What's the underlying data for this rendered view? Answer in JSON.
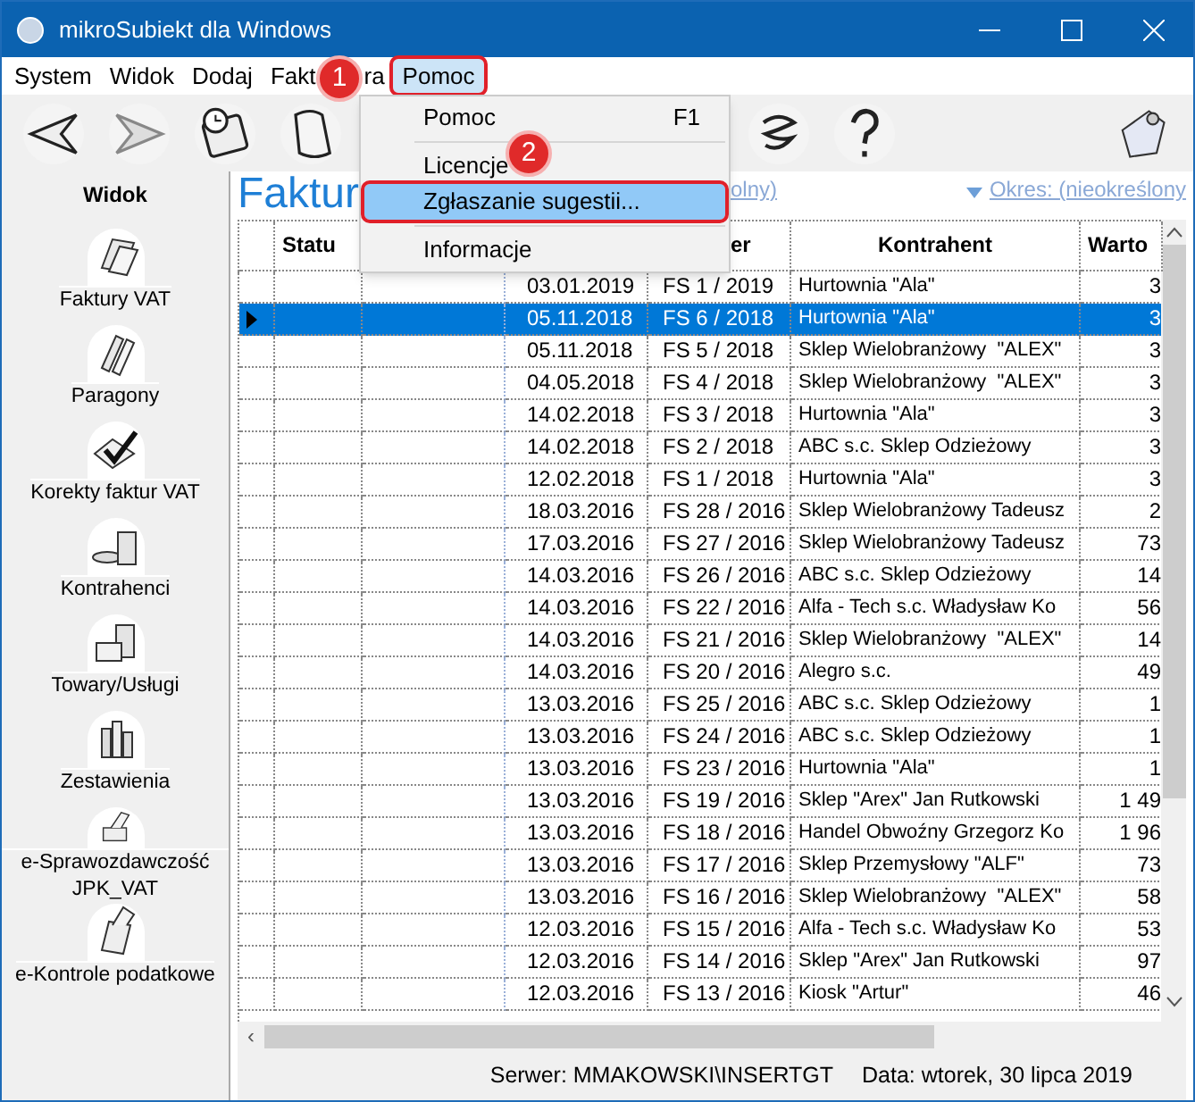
{
  "window": {
    "title": "mikroSubiekt dla Windows"
  },
  "menu_bar": [
    {
      "label": "System",
      "selected": false
    },
    {
      "label": "Widok",
      "selected": false
    },
    {
      "label": "Dodaj",
      "selected": false
    },
    {
      "label": "Fakt",
      "tail": "ra",
      "selected": false
    },
    {
      "label": "Pomoc",
      "selected": true
    }
  ],
  "dropdown": {
    "items": [
      {
        "kind": "item",
        "label": "Pomoc",
        "shortcut": "F1",
        "selected": false
      },
      {
        "kind": "separator"
      },
      {
        "kind": "item",
        "label": "Licencje",
        "selected": false
      },
      {
        "kind": "item",
        "label": "Zgłaszanie sugestii...",
        "selected": true
      },
      {
        "kind": "separator"
      },
      {
        "kind": "item",
        "label": "Informacje",
        "selected": false
      }
    ]
  },
  "step_badges": [
    "1",
    "2"
  ],
  "sidebar": {
    "title": "Widok",
    "items": [
      {
        "label": "Faktury VAT"
      },
      {
        "label": "Paragony"
      },
      {
        "label": "Korekty faktur VAT"
      },
      {
        "label": "Kontrahenci"
      },
      {
        "label": "Towary/Usługi"
      },
      {
        "label": "Zestawienia"
      },
      {
        "label": "e-Sprawozdawczość JPK_VAT"
      },
      {
        "label": "e-Kontrole podatkowe"
      }
    ]
  },
  "page": {
    "title": "Faktur",
    "filter_link": "olny)",
    "period_link": "Okres: (nieokreślony"
  },
  "table": {
    "columns": [
      "",
      "Statu",
      "",
      "",
      "er",
      "Kontrahent",
      "Warto"
    ],
    "scroll_left": "‹",
    "rows": [
      {
        "date": "03.01.2019",
        "number": "FS 1 / 2019",
        "party": "Hurtownia \"Ala\"",
        "value": "3",
        "selected": false
      },
      {
        "date": "05.11.2018",
        "number": "FS 6 / 2018",
        "party": "Hurtownia \"Ala\"",
        "value": "3",
        "selected": true
      },
      {
        "date": "05.11.2018",
        "number": "FS 5 / 2018",
        "party": "Sklep Wielobranżowy  \"ALEX\"",
        "value": "3",
        "selected": false
      },
      {
        "date": "04.05.2018",
        "number": "FS 4 / 2018",
        "party": "Sklep Wielobranżowy  \"ALEX\"",
        "value": "3",
        "selected": false
      },
      {
        "date": "14.02.2018",
        "number": "FS 3 / 2018",
        "party": "Hurtownia \"Ala\"",
        "value": "3",
        "selected": false
      },
      {
        "date": "14.02.2018",
        "number": "FS 2 / 2018",
        "party": "ABC s.c. Sklep Odzieżowy",
        "value": "3",
        "selected": false
      },
      {
        "date": "12.02.2018",
        "number": "FS 1 / 2018",
        "party": "Hurtownia \"Ala\"",
        "value": "3",
        "selected": false
      },
      {
        "date": "18.03.2016",
        "number": "FS 28 / 2016",
        "party": "Sklep Wielobranżowy Tadeusz",
        "value": "2",
        "selected": false
      },
      {
        "date": "17.03.2016",
        "number": "FS 27 / 2016",
        "party": "Sklep Wielobranżowy Tadeusz",
        "value": "73",
        "selected": false
      },
      {
        "date": "14.03.2016",
        "number": "FS 26 / 2016",
        "party": "ABC s.c. Sklep Odzieżowy",
        "value": "14",
        "selected": false
      },
      {
        "date": "14.03.2016",
        "number": "FS 22 / 2016",
        "party": "Alfa - Tech s.c. Władysław Ko",
        "value": "56",
        "selected": false
      },
      {
        "date": "14.03.2016",
        "number": "FS 21 / 2016",
        "party": "Sklep Wielobranżowy  \"ALEX\"",
        "value": "14",
        "selected": false
      },
      {
        "date": "14.03.2016",
        "number": "FS 20 / 2016",
        "party": "Alegro s.c.",
        "value": "49",
        "selected": false
      },
      {
        "date": "13.03.2016",
        "number": "FS 25 / 2016",
        "party": "ABC s.c. Sklep Odzieżowy",
        "value": "1",
        "selected": false
      },
      {
        "date": "13.03.2016",
        "number": "FS 24 / 2016",
        "party": "ABC s.c. Sklep Odzieżowy",
        "value": "1",
        "selected": false
      },
      {
        "date": "13.03.2016",
        "number": "FS 23 / 2016",
        "party": "Hurtownia \"Ala\"",
        "value": "1",
        "selected": false
      },
      {
        "date": "13.03.2016",
        "number": "FS 19 / 2016",
        "party": "Sklep \"Arex\" Jan Rutkowski",
        "value": "1 49",
        "selected": false
      },
      {
        "date": "13.03.2016",
        "number": "FS 18 / 2016",
        "party": "Handel Obwoźny Grzegorz Ko",
        "value": "1 96",
        "selected": false
      },
      {
        "date": "13.03.2016",
        "number": "FS 17 / 2016",
        "party": "Sklep Przemysłowy \"ALF\"",
        "value": "73",
        "selected": false
      },
      {
        "date": "13.03.2016",
        "number": "FS 16 / 2016",
        "party": "Sklep Wielobranżowy  \"ALEX\"",
        "value": "58",
        "selected": false
      },
      {
        "date": "12.03.2016",
        "number": "FS 15 / 2016",
        "party": "Alfa - Tech s.c. Władysław Ko",
        "value": "53",
        "selected": false
      },
      {
        "date": "12.03.2016",
        "number": "FS 14 / 2016",
        "party": "Sklep \"Arex\" Jan Rutkowski",
        "value": "97",
        "selected": false
      },
      {
        "date": "12.03.2016",
        "number": "FS 13 / 2016",
        "party": "Kiosk \"Artur\"",
        "value": "46",
        "selected": false
      }
    ]
  },
  "status_bar": {
    "server": "Serwer: MMAKOWSKI\\INSERTGT",
    "date": "Data: wtorek, 30 lipca 2019"
  }
}
